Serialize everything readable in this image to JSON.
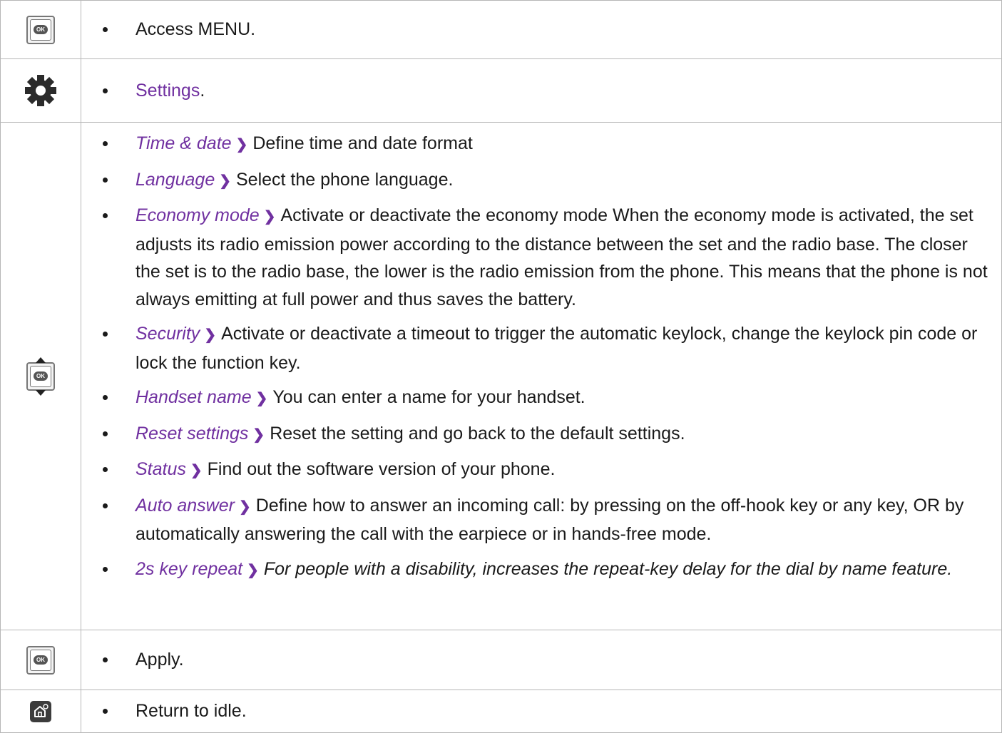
{
  "rows": [
    {
      "icon": "ok-key-icon",
      "items": [
        {
          "text": "Access MENU."
        }
      ]
    },
    {
      "icon": "gear-icon",
      "items": [
        {
          "link": "Settings",
          "suffix": "."
        }
      ]
    },
    {
      "icon": "navigator-key-icon",
      "items": [
        {
          "term": "Time & date",
          "desc": "Define time and date format"
        },
        {
          "term": "Language",
          "desc": "Select the phone language."
        },
        {
          "term": "Economy mode",
          "desc": "Activate or deactivate the economy mode When the economy mode is activated, the set adjusts its radio emission power according to the distance between the set and the radio base. The closer the set is to the radio base, the lower is the radio emission from the phone. This means that the phone is not always emitting at full power and thus saves the battery."
        },
        {
          "term": "Security",
          "desc": "Activate or deactivate a timeout to trigger the automatic keylock, change the keylock pin code or lock the function key."
        },
        {
          "term": "Handset name",
          "desc": "You can enter a name for your handset."
        },
        {
          "term": "Reset settings",
          "desc": "Reset the setting and go back to the default settings."
        },
        {
          "term": "Status",
          "desc": "Find out the software version of your phone."
        },
        {
          "term": "Auto answer",
          "desc": "Define how to answer an incoming call: by pressing on the off-hook key or any key, OR by automatically answering the call with the earpiece or in hands-free mode."
        },
        {
          "term": "2s key repeat",
          "desc": "For people with a disability, increases the repeat-key delay for the dial by name feature."
        }
      ]
    },
    {
      "icon": "ok-key-icon",
      "items": [
        {
          "text": "Apply."
        }
      ]
    },
    {
      "icon": "home-key-icon",
      "items": [
        {
          "text": "Return to idle."
        }
      ]
    }
  ],
  "colors": {
    "accent": "#7030a0",
    "border": "#b7b7b7",
    "text": "#1a1a1a"
  },
  "ok_label": "OK",
  "chevron": "❯"
}
